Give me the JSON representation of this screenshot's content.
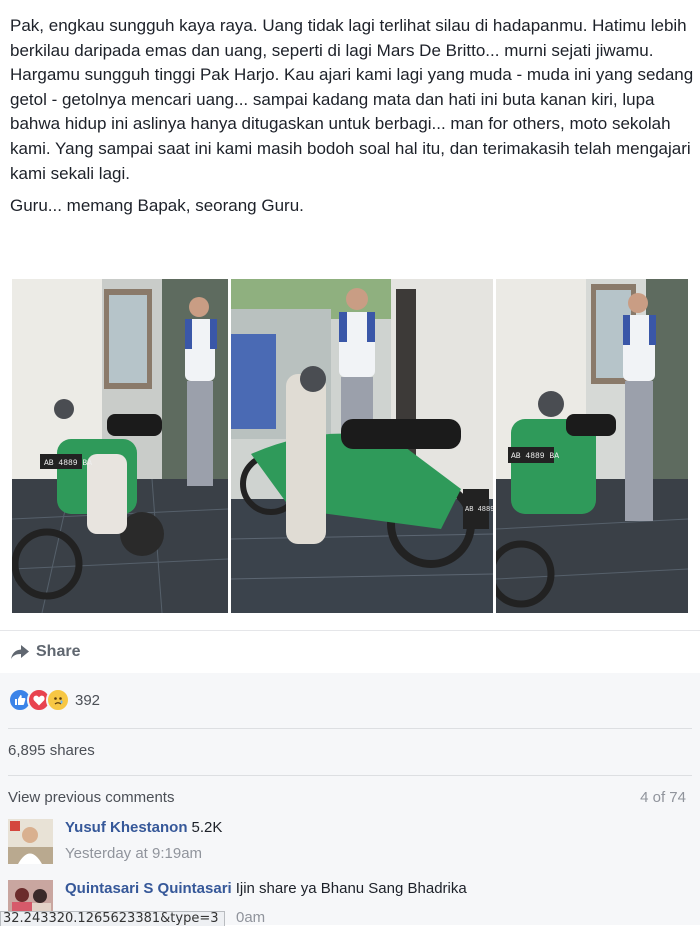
{
  "post": {
    "paragraph_1": "Pak, engkau sungguh kaya raya. Uang tidak lagi terlihat silau di hadapanmu. Hatimu lebih berkilau daripada emas dan uang, seperti di lagi Mars De Britto... murni sejati jiwamu. Hargamu sungguh tinggi Pak Harjo. Kau ajari kami lagi yang muda - muda ini yang sedang getol - getolnya mencari uang... sampai kadang mata dan hati ini buta kanan kiri, lupa bahwa hidup ini aslinya hanya ditugaskan untuk berbagi... man for others, moto sekolah kami. Yang sampai saat ini kami masih bodoh soal hal itu, dan terimakasih telah mengajari kami sekali lagi.",
    "paragraph_2": "Guru... memang Bapak, seorang Guru.",
    "photo_plates": [
      "AB 4889 BA",
      "AB 4889",
      "AB 4889 BA"
    ]
  },
  "actions": {
    "share_label": "Share"
  },
  "reactions": {
    "icons": [
      "like-icon",
      "love-icon",
      "sad-icon"
    ],
    "count": "392"
  },
  "shares": {
    "label": "6,895 shares"
  },
  "previous_comments": {
    "label": "View previous comments",
    "count": "4 of 74"
  },
  "comments": [
    {
      "name": "Yusuf Khestanon",
      "text": "5.2K",
      "time": "Yesterday at 9:19am"
    },
    {
      "name": "Quintasari S Quintasari",
      "text": "Ijin share ya Bhanu Sang Bhadrika",
      "time": "0am"
    }
  ],
  "status_bar": {
    "url": "32.243320.1265623381&type=3"
  },
  "colors": {
    "link": "#365899",
    "text": "#1d2129",
    "muted": "#90949c",
    "motor_green": "#2f9a5a"
  }
}
